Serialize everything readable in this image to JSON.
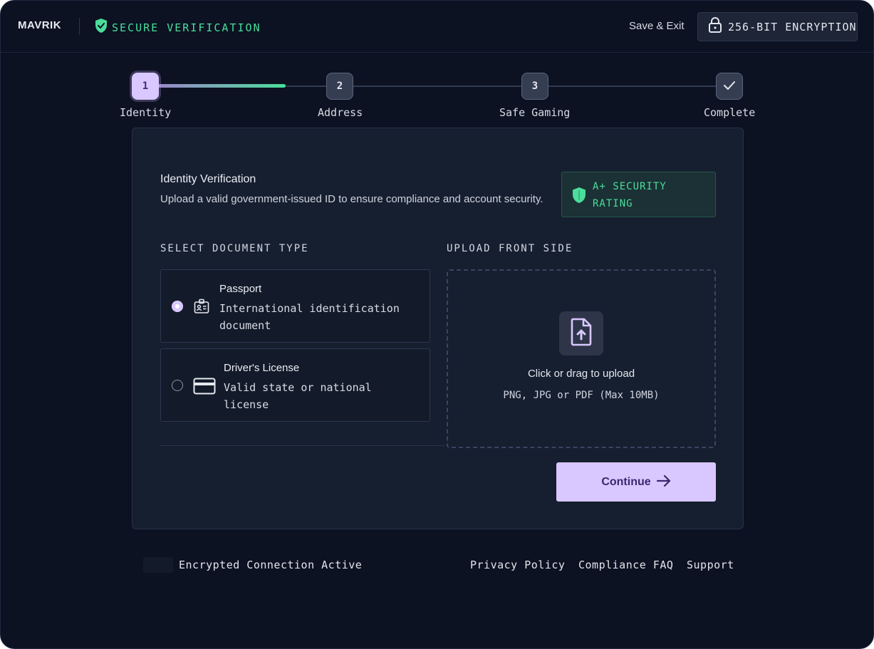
{
  "header": {
    "brand": "MAVRIK",
    "secure_label": "SECURE VERIFICATION",
    "save_exit": "Save & Exit",
    "encryption_badge": "256-BIT ENCRYPTION",
    "accent_green": "#4ade9a"
  },
  "stepper": {
    "steps": [
      {
        "number": "1",
        "label": "Identity",
        "state": "active"
      },
      {
        "number": "2",
        "label": "Address",
        "state": "pending"
      },
      {
        "number": "3",
        "label": "Safe Gaming",
        "state": "pending"
      },
      {
        "number": "",
        "label": "Complete",
        "state": "final",
        "icon": "check-icon"
      }
    ],
    "progress_fraction": 0.22
  },
  "card": {
    "title": "Identity Verification",
    "subtitle": "Upload a valid government-issued ID to ensure compliance and account security.",
    "rating_badge": "A+ SECURITY RATING",
    "document_section_label": "SELECT DOCUMENT TYPE",
    "documents": [
      {
        "name": "Passport",
        "description": "International identification document",
        "selected": true,
        "icon": "id-card-icon"
      },
      {
        "name": "Driver's License",
        "description": "Valid state or national license",
        "selected": false,
        "icon": "credit-card-icon"
      }
    ],
    "upload_section_label": "UPLOAD FRONT SIDE",
    "upload": {
      "title": "Click or drag to upload",
      "hint": "PNG, JPG or PDF (Max 10MB)",
      "icon": "file-upload-icon"
    },
    "continue_label": "Continue",
    "accent_purple": "#d9c8ff"
  },
  "footer": {
    "status": "Encrypted Connection Active",
    "links": [
      "Privacy Policy",
      "Compliance FAQ",
      "Support"
    ]
  }
}
